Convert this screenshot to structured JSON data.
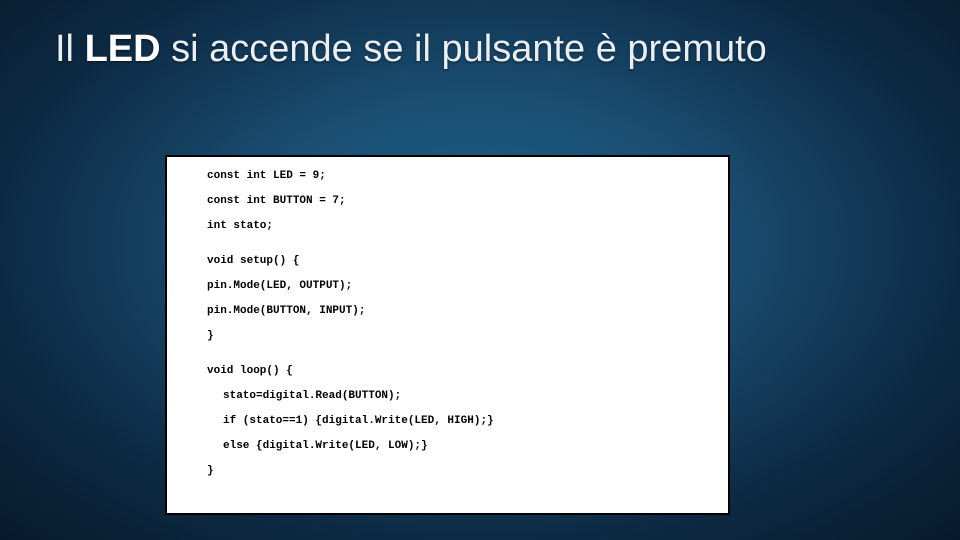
{
  "title_html": "Il <b>LED</b> si accende se il pulsante è premuto",
  "code": {
    "l1": "const int LED = 9;",
    "l2": "const int BUTTON = 7;",
    "l3": "int stato;",
    "l4": "void setup() {",
    "l5": "pin.Mode(LED, OUTPUT);",
    "l6": "pin.Mode(BUTTON, INPUT);",
    "l7": "}",
    "l8": "void loop() {",
    "l9": "stato=digital.Read(BUTTON);",
    "l10": "if (stato==1) {digital.Write(LED, HIGH);}",
    "l11": "else {digital.Write(LED, LOW);}",
    "l12": "}"
  }
}
